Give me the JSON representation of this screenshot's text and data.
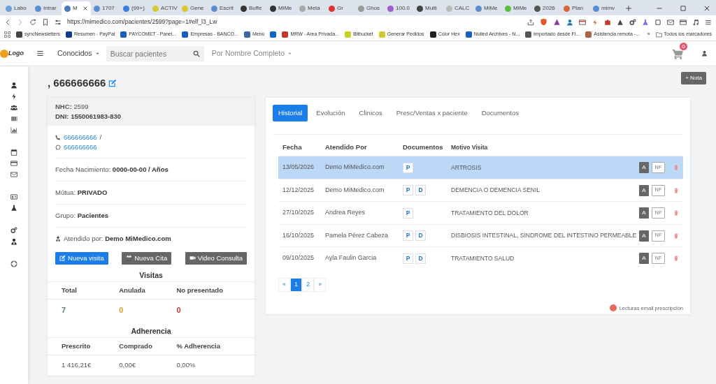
{
  "browser": {
    "tabs": [
      {
        "label": "Labo",
        "selected": false
      },
      {
        "label": "Intrar",
        "selected": false
      },
      {
        "label": "M",
        "selected": true
      },
      {
        "label": "1707",
        "selected": false
      },
      {
        "label": "(99+)",
        "selected": false
      },
      {
        "label": "ACTIV",
        "selected": false
      },
      {
        "label": "Gene",
        "selected": false
      },
      {
        "label": "Escrit",
        "selected": false
      },
      {
        "label": "Buffe",
        "selected": false
      },
      {
        "label": "MiMe",
        "selected": false
      },
      {
        "label": "Meta",
        "selected": false
      },
      {
        "label": "Gr",
        "selected": false
      },
      {
        "label": "Ghos",
        "selected": false
      },
      {
        "label": "100.0",
        "selected": false
      },
      {
        "label": "Multi",
        "selected": false
      },
      {
        "label": "CALC",
        "selected": false
      },
      {
        "label": "MiMe",
        "selected": false
      },
      {
        "label": "MiMe",
        "selected": false
      },
      {
        "label": "2026",
        "selected": false
      },
      {
        "label": "Plan",
        "selected": false
      },
      {
        "label": "mimv",
        "selected": false
      }
    ],
    "url": "https://mimedico.com/pacientes/2599?page=1#elf_l3_Lw",
    "bookmarks": [
      {
        "label": "syncNewsletters"
      },
      {
        "label": "Resumen - PayPal"
      },
      {
        "label": "PAYCOMET - Panel..."
      },
      {
        "label": "Empresas - BANCO..."
      },
      {
        "label": "Menú"
      },
      {
        "kind": "icon"
      },
      {
        "label": "MRW - Area Privada..."
      },
      {
        "label": "Bitbucket"
      },
      {
        "label": "Generar Pedidos"
      },
      {
        "label": "Color Hex"
      },
      {
        "label": "Nulled Archives - N..."
      },
      {
        "label": "Importado desde Fi..."
      },
      {
        "label": "Asistencia remota -..."
      }
    ],
    "more": "»",
    "all_bookmarks": "Todos los marcadores"
  },
  "app": {
    "logo": "Logo",
    "filter": "Conocidos",
    "search_placeholder": "Buscar pacientes",
    "search_by": "Por Nombre Completo",
    "cart_count": "0"
  },
  "patient": {
    "title": ", 666666666",
    "add_note": "+ Nota",
    "nhc_label": "NHC:",
    "nhc": "2599",
    "dni": "DNI: 1550061983-830",
    "phone": "666666666",
    "separator": "/",
    "whatsapp": "666666666",
    "fields": [
      {
        "label": "Fecha Nacimiento:",
        "value": "0000-00-00 / Años"
      },
      {
        "label": "Mútua:",
        "value": "PRIVADO"
      },
      {
        "label": "Grupo:",
        "value": "Pacientes"
      },
      {
        "label": "Atendido por:",
        "value": "Demo MiMedico.com"
      }
    ],
    "buttons": [
      {
        "label": "Nueva visita",
        "kind": "primary"
      },
      {
        "label": "Nueva Cita",
        "kind": "secondary"
      },
      {
        "label": "Video Consulta",
        "kind": "secondary"
      }
    ],
    "visitas": {
      "title": "Visitas",
      "columns": [
        "Total",
        "Anulada",
        "No presentado"
      ],
      "values": [
        {
          "text": "7",
          "color": "#5f7f6a"
        },
        {
          "text": "0",
          "color": "#e0a030"
        },
        {
          "text": "0",
          "color": "#c0392b"
        }
      ]
    },
    "adherencia": {
      "title": "Adherencia",
      "columns": [
        "Prescrito",
        "Comprado",
        "% Adherencia"
      ],
      "values": [
        "1 416,21€",
        "0,00€",
        "0,00%"
      ]
    }
  },
  "history": {
    "tabs": [
      {
        "label": "Historial",
        "selected": true
      },
      {
        "label": "Evolución",
        "selected": false
      },
      {
        "label": "Clinicos",
        "selected": false
      },
      {
        "label": "Presc/Ventas x paciente",
        "selected": false
      },
      {
        "label": "Documentos",
        "selected": false
      }
    ],
    "columns": [
      "Fecha",
      "Atendido Por",
      "Documentos",
      "Motivo Visita"
    ],
    "rows": [
      {
        "fecha": "13/05/2026",
        "atendido": "Demo MiMedico.com",
        "docs": [
          "P"
        ],
        "motivo": "ARTROSIS",
        "selected": true,
        "a": "A",
        "nf": "NF"
      },
      {
        "fecha": "12/12/2025",
        "atendido": "Demo MiMedico.com",
        "docs": [
          "P",
          "D"
        ],
        "motivo": "DEMENCIA O DEMENCIA SENIL",
        "selected": false,
        "a": "A",
        "nf": "NF"
      },
      {
        "fecha": "27/10/2025",
        "atendido": "Andrea Reyes",
        "docs": [
          "P"
        ],
        "motivo": "TRATAMIENTO DEL DOLOR",
        "selected": false,
        "a": "A",
        "nf": "NF"
      },
      {
        "fecha": "16/10/2025",
        "atendido": "Pamela Pérez Cabeza",
        "docs": [
          "P",
          "D"
        ],
        "motivo": "DISBIOSIS INTESTINAL, SINDROME DEL INTESTINO PERMEABLE",
        "selected": false,
        "a": "A",
        "nf": "NF"
      },
      {
        "fecha": "09/10/2025",
        "atendido": "Ayla Faulin Garcia",
        "docs": [
          "P",
          "D"
        ],
        "motivo": "TRATAMIENTO SALUD",
        "selected": false,
        "a": "A",
        "nf": "NF"
      }
    ],
    "pagination": {
      "prev": "«",
      "pages": [
        {
          "label": "1",
          "selected": true
        },
        {
          "label": "2",
          "selected": false
        }
      ],
      "next": "»"
    },
    "footer": "Lecturas email prescripción"
  }
}
